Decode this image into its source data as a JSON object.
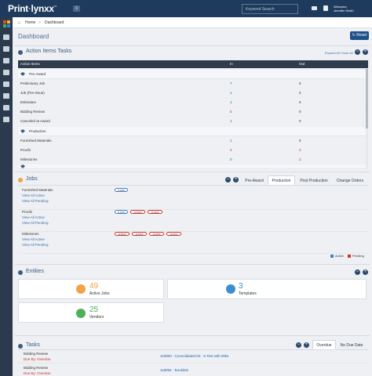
{
  "topbar": {
    "logo": "Print",
    "logo_suffix": "lynxx",
    "logo_tm": "™",
    "search_placeholder": "Keyword Search",
    "welcome": "Welcome,",
    "user_name": "Jennifer Smith"
  },
  "breadcrumb": {
    "home": "Home",
    "separator": ">",
    "current": "Dashboard"
  },
  "page": {
    "title": "Dashboard",
    "reset_label": "Reset"
  },
  "action_items": {
    "title": "Action Items Tasks",
    "expand_all": "Expand All",
    "close_all": "Close All",
    "columns": [
      "Action Items",
      "In",
      "Out"
    ],
    "groups": [
      {
        "name": "Pre-Award",
        "rows": [
          {
            "label": "Preliminary Job",
            "in": "7",
            "out": "0",
            "in_color": "blue"
          },
          {
            "label": "Job (Pre-Issue)",
            "in": "1",
            "out": "0",
            "in_color": "blue"
          },
          {
            "label": "Estimates",
            "in": "1",
            "out": "0",
            "in_color": "blue"
          },
          {
            "label": "Bidding Review",
            "in": "5",
            "out": "0",
            "in_color": "red"
          },
          {
            "label": "Canceled at Award",
            "in": "1",
            "out": "0",
            "in_color": "blue"
          }
        ]
      },
      {
        "name": "Production",
        "rows": [
          {
            "label": "Furnished Materials",
            "in": "1",
            "out": "0",
            "in_color": "blue"
          },
          {
            "label": "Proofs",
            "in": "2",
            "out": "3",
            "in_color": "red",
            "out_color": "red"
          },
          {
            "label": "Milestones",
            "in": "0",
            "out": "3",
            "in_color": "blue",
            "out_color": "red"
          }
        ]
      }
    ]
  },
  "jobs": {
    "title": "Jobs",
    "tabs": [
      "Pre-Award",
      "Production",
      "Post Production",
      "Change Orders"
    ],
    "active_tab": "Production",
    "view_all_active": "View All Active",
    "view_all_pending": "View All Pending",
    "rows": [
      {
        "title": "Furnished Materials",
        "pills": [
          "116890"
        ]
      },
      {
        "title": "Proofs",
        "pills": [
          "116490",
          "116359",
          "116493"
        ]
      },
      {
        "title": "Milestones",
        "pills": [
          "115840",
          "116359",
          "116456",
          "116493"
        ]
      }
    ],
    "legend_active": "Active",
    "legend_pending": "Pending",
    "active_color": "#4a7fc0",
    "pending_color": "#d0332f"
  },
  "entities": {
    "title": "Entities",
    "cards": [
      {
        "value": "49",
        "label": "Active Jobs",
        "color": "#f0a34a"
      },
      {
        "value": "3",
        "label": "Templates",
        "color": "#3b8fd1"
      },
      {
        "value": "25",
        "label": "Vendors",
        "color": "#4db05a"
      }
    ]
  },
  "tasks": {
    "title": "Tasks",
    "tabs": [
      "Overdue",
      "No Due Date"
    ],
    "active_tab": "Overdue",
    "rows": [
      {
        "title": "Bidding Review",
        "status": "Due By: Overdue",
        "link": "118900 - Consolidated Kit - 5 Test with Mike"
      },
      {
        "title": "Bidding Review",
        "status": "Due By: Overdue",
        "link": "118894 - Booklets"
      }
    ]
  }
}
